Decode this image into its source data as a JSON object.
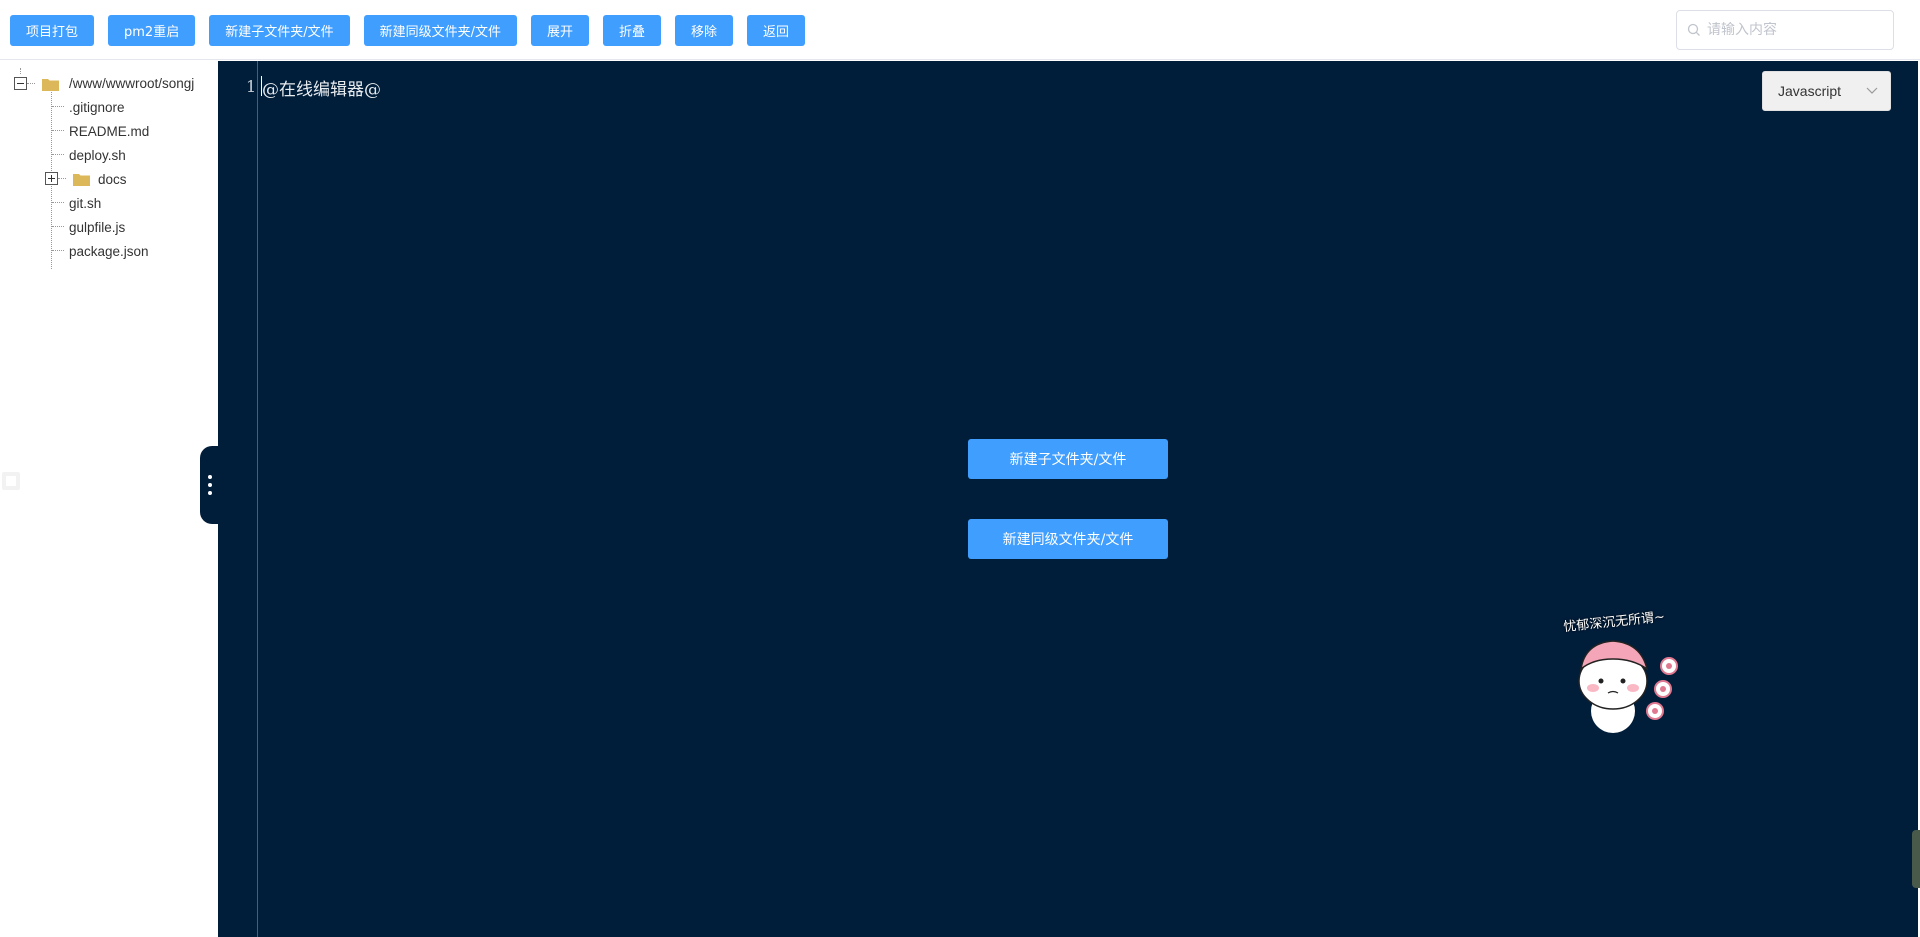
{
  "toolbar": {
    "buttons": [
      "项目打包",
      "pm2重启",
      "新建子文件夹/文件",
      "新建同级文件夹/文件",
      "展开",
      "折叠",
      "移除",
      "返回"
    ]
  },
  "search": {
    "placeholder": "请输入内容",
    "value": ""
  },
  "tree": {
    "root": "/www/wwwroot/songj",
    "children": [
      ".gitignore",
      "README.md",
      "deploy.sh",
      "docs",
      "git.sh",
      "gulpfile.js",
      "package.json"
    ]
  },
  "editor": {
    "line_number": "1",
    "code": "@在线编辑器@",
    "language": "Javascript",
    "create_child_label": "新建子文件夹/文件",
    "create_sibling_label": "新建同级文件夹/文件"
  },
  "sticker": {
    "text": "忧郁深沉无所谓~"
  },
  "colors": {
    "primary": "#409eff",
    "editor_bg": "#001d3a",
    "folder": "#dcb85a"
  }
}
